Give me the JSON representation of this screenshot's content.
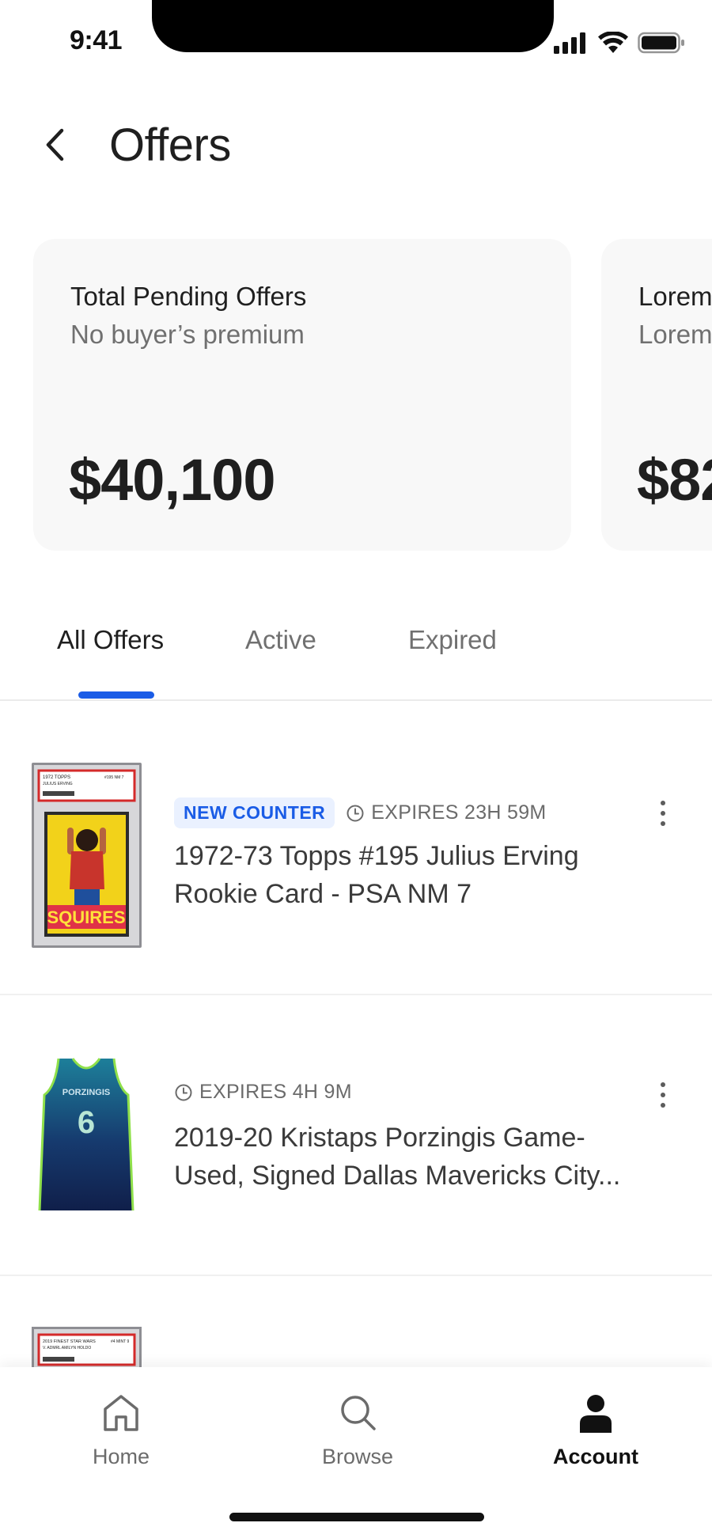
{
  "status_bar": {
    "time": "9:41"
  },
  "header": {
    "title": "Offers"
  },
  "summary_cards": [
    {
      "title": "Total Pending Offers",
      "subtitle": "No buyer’s premium",
      "amount": "$40,100"
    },
    {
      "title": "Lorem",
      "subtitle": "Lorem",
      "amount": "$82"
    }
  ],
  "tabs": [
    {
      "label": "All Offers",
      "active": true
    },
    {
      "label": "Active",
      "active": false
    },
    {
      "label": "Expired",
      "active": false
    }
  ],
  "offers": [
    {
      "badge": "NEW COUNTER",
      "expires": "EXPIRES 23H 59M",
      "name": "1972-73 Topps #195 Julius Erving Rookie Card - PSA NM 7",
      "slab_top": "1972 TOPPS",
      "slab_player": "JULIUS ERVING",
      "slab_grade": "#195 NM 7",
      "card_team": "SQUIRES"
    },
    {
      "badge": "",
      "expires": "EXPIRES 4H 9M",
      "name_line1": "2019-20 Kristaps Porzingis Game-",
      "name_line2": "Used, Signed Dallas Mavericks City...",
      "jersey_name": "PORZINGIS",
      "jersey_number": "6"
    },
    {
      "slab_top": "2019 FINEST STAR WARS",
      "slab_player": "V. ADMRL AMILYN HOLDO",
      "slab_grade": "#4 MINT 9"
    }
  ],
  "bottom_nav": [
    {
      "label": "Home",
      "icon": "home-icon",
      "active": false
    },
    {
      "label": "Browse",
      "icon": "search-icon",
      "active": false
    },
    {
      "label": "Account",
      "icon": "account-icon",
      "active": true
    }
  ],
  "colors": {
    "accent": "#1a5ce6",
    "card_bg": "#f8f8f8",
    "text_primary": "#1f1f1f",
    "text_secondary": "#707070"
  }
}
